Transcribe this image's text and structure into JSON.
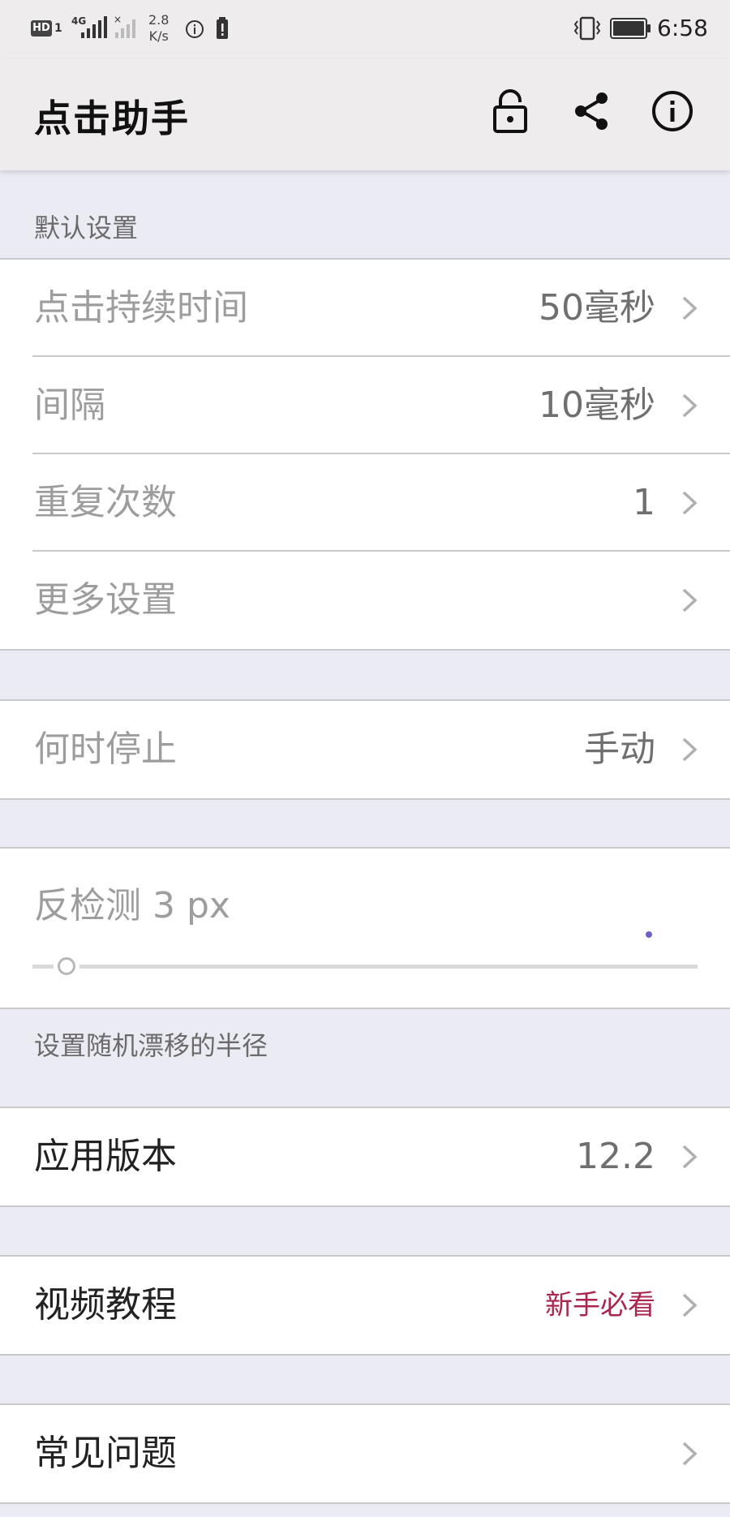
{
  "status_bar": {
    "hd": "HD",
    "sim": "1",
    "net": "4G",
    "speed_value": "2.8",
    "speed_unit": "K/s",
    "time": "6:58",
    "icons": [
      "signal-icon",
      "info-icon",
      "warning-icon",
      "vibrate-icon",
      "battery-icon"
    ]
  },
  "app_bar": {
    "title": "点击助手",
    "actions": [
      "lock-icon",
      "share-icon",
      "info-icon"
    ]
  },
  "default_section": {
    "header": "默认设置",
    "rows": [
      {
        "label": "点击持续时间",
        "value": "50毫秒"
      },
      {
        "label": "间隔",
        "value": "10毫秒"
      },
      {
        "label": "重复次数",
        "value": "1"
      },
      {
        "label": "更多设置",
        "value": ""
      }
    ]
  },
  "stop_row": {
    "label": "何时停止",
    "value": "手动"
  },
  "anti_detect": {
    "label": "反检测 3 px",
    "slider_value": 3,
    "help": "设置随机漂移的半径"
  },
  "version_row": {
    "label": "应用版本",
    "value": "12.2"
  },
  "video_row": {
    "label": "视频教程",
    "value": "新手必看"
  },
  "faq_row": {
    "label": "常见问题"
  },
  "colors": {
    "accent_value": "#a9264e",
    "slider_dot": "#6c63c9",
    "background": "#ebebf3"
  }
}
